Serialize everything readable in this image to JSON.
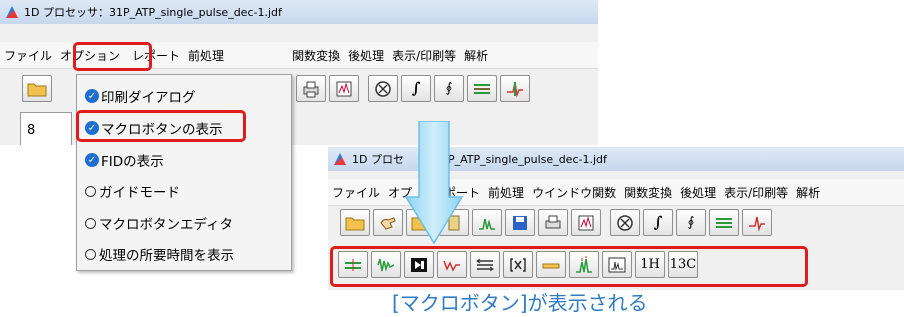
{
  "window1": {
    "title": "1D プロセッサ：31P_ATP_single_pulse_dec-1.jdf",
    "menu": [
      "ファイル",
      "オプション",
      "レポート",
      "前処理",
      "関数変換",
      "後処理",
      "表示/印刷等",
      "解析"
    ],
    "partial_tab_text": "8"
  },
  "dropdown": {
    "items": [
      {
        "label": "印刷ダイアログ",
        "mark": "check"
      },
      {
        "label": "マクロボタンの表示",
        "mark": "check"
      },
      {
        "label": "FIDの表示",
        "mark": "check"
      },
      {
        "label": "ガイドモード",
        "mark": "radio"
      },
      {
        "label": "マクロボタンエディタ",
        "mark": "radio"
      },
      {
        "label": "処理の所要時間を表示",
        "mark": "radio"
      }
    ]
  },
  "window2": {
    "title": "1D プロセ",
    "title_file": "31P_ATP_single_pulse_dec-1.jdf",
    "menu": [
      "ファイル",
      "オプ",
      "レポート",
      "前処理",
      "ウインドウ関数",
      "関数変換",
      "後処理",
      "表示/印刷等",
      "解析"
    ],
    "macro_buttons": [
      "1H",
      "13C"
    ]
  },
  "caption": "[マクロボタン]が表示される",
  "colors": {
    "highlight": "#e01b1b",
    "accent": "#2f7cc4",
    "check": "#1f6fd1"
  }
}
